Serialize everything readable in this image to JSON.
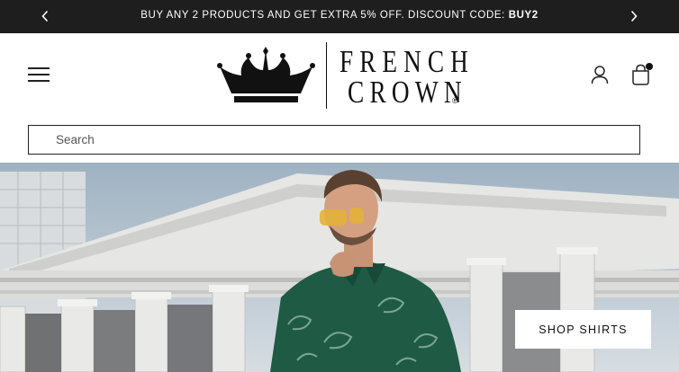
{
  "announcement": {
    "text": "BUY ANY 2 PRODUCTS AND GET EXTRA 5% OFF. DISCOUNT CODE: ",
    "code": "BUY2",
    "prev_icon": "chevron-left-icon",
    "next_icon": "chevron-right-icon"
  },
  "header": {
    "menu_icon": "hamburger-menu-icon",
    "logo": {
      "line1": "FRENCH",
      "line2": "CROWN",
      "reg": "®"
    },
    "account_icon": "user-icon",
    "cart_icon": "shopping-bag-icon"
  },
  "search": {
    "placeholder": "Search",
    "value": ""
  },
  "hero": {
    "cta_label": "SHOP SHIRTS"
  },
  "colors": {
    "announce_bg": "#1e1e1e",
    "text": "#111111",
    "shirt": "#1f5a45"
  }
}
